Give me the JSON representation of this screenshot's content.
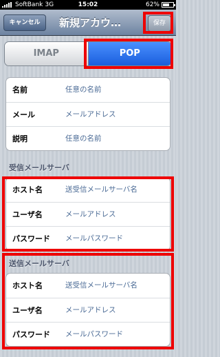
{
  "status_bar": {
    "carrier": "SoftBank",
    "network": "3G",
    "time": "15:02",
    "battery_text": "62%",
    "battery_level": 0.62
  },
  "nav": {
    "cancel_label": "キャンセル",
    "title": "新規アカウ…",
    "save_label": "保存"
  },
  "protocol": {
    "options": [
      "IMAP",
      "POP"
    ],
    "selected": "POP"
  },
  "account": {
    "rows": [
      {
        "label": "名前",
        "value": "任意の名前"
      },
      {
        "label": "メール",
        "value": "メールアドレス"
      },
      {
        "label": "説明",
        "value": "任意の名前"
      }
    ]
  },
  "incoming": {
    "header": "受信メールサーバ",
    "rows": [
      {
        "label": "ホスト名",
        "value": "送受信メールサーバ名"
      },
      {
        "label": "ユーザ名",
        "value": "メールアドレス"
      },
      {
        "label": "パスワード",
        "value": "メールパスワード"
      }
    ]
  },
  "outgoing": {
    "header": "送信メールサーバ",
    "rows": [
      {
        "label": "ホスト名",
        "value": "送受信メールサーバ名"
      },
      {
        "label": "ユーザ名",
        "value": "メールアドレス"
      },
      {
        "label": "パスワード",
        "value": "メールパスワード"
      }
    ]
  },
  "colors": {
    "highlight": "#ee0000",
    "nav_bar": "#8095b2",
    "selected_segment": "#2f78f0",
    "background": "#c5ccd4"
  }
}
